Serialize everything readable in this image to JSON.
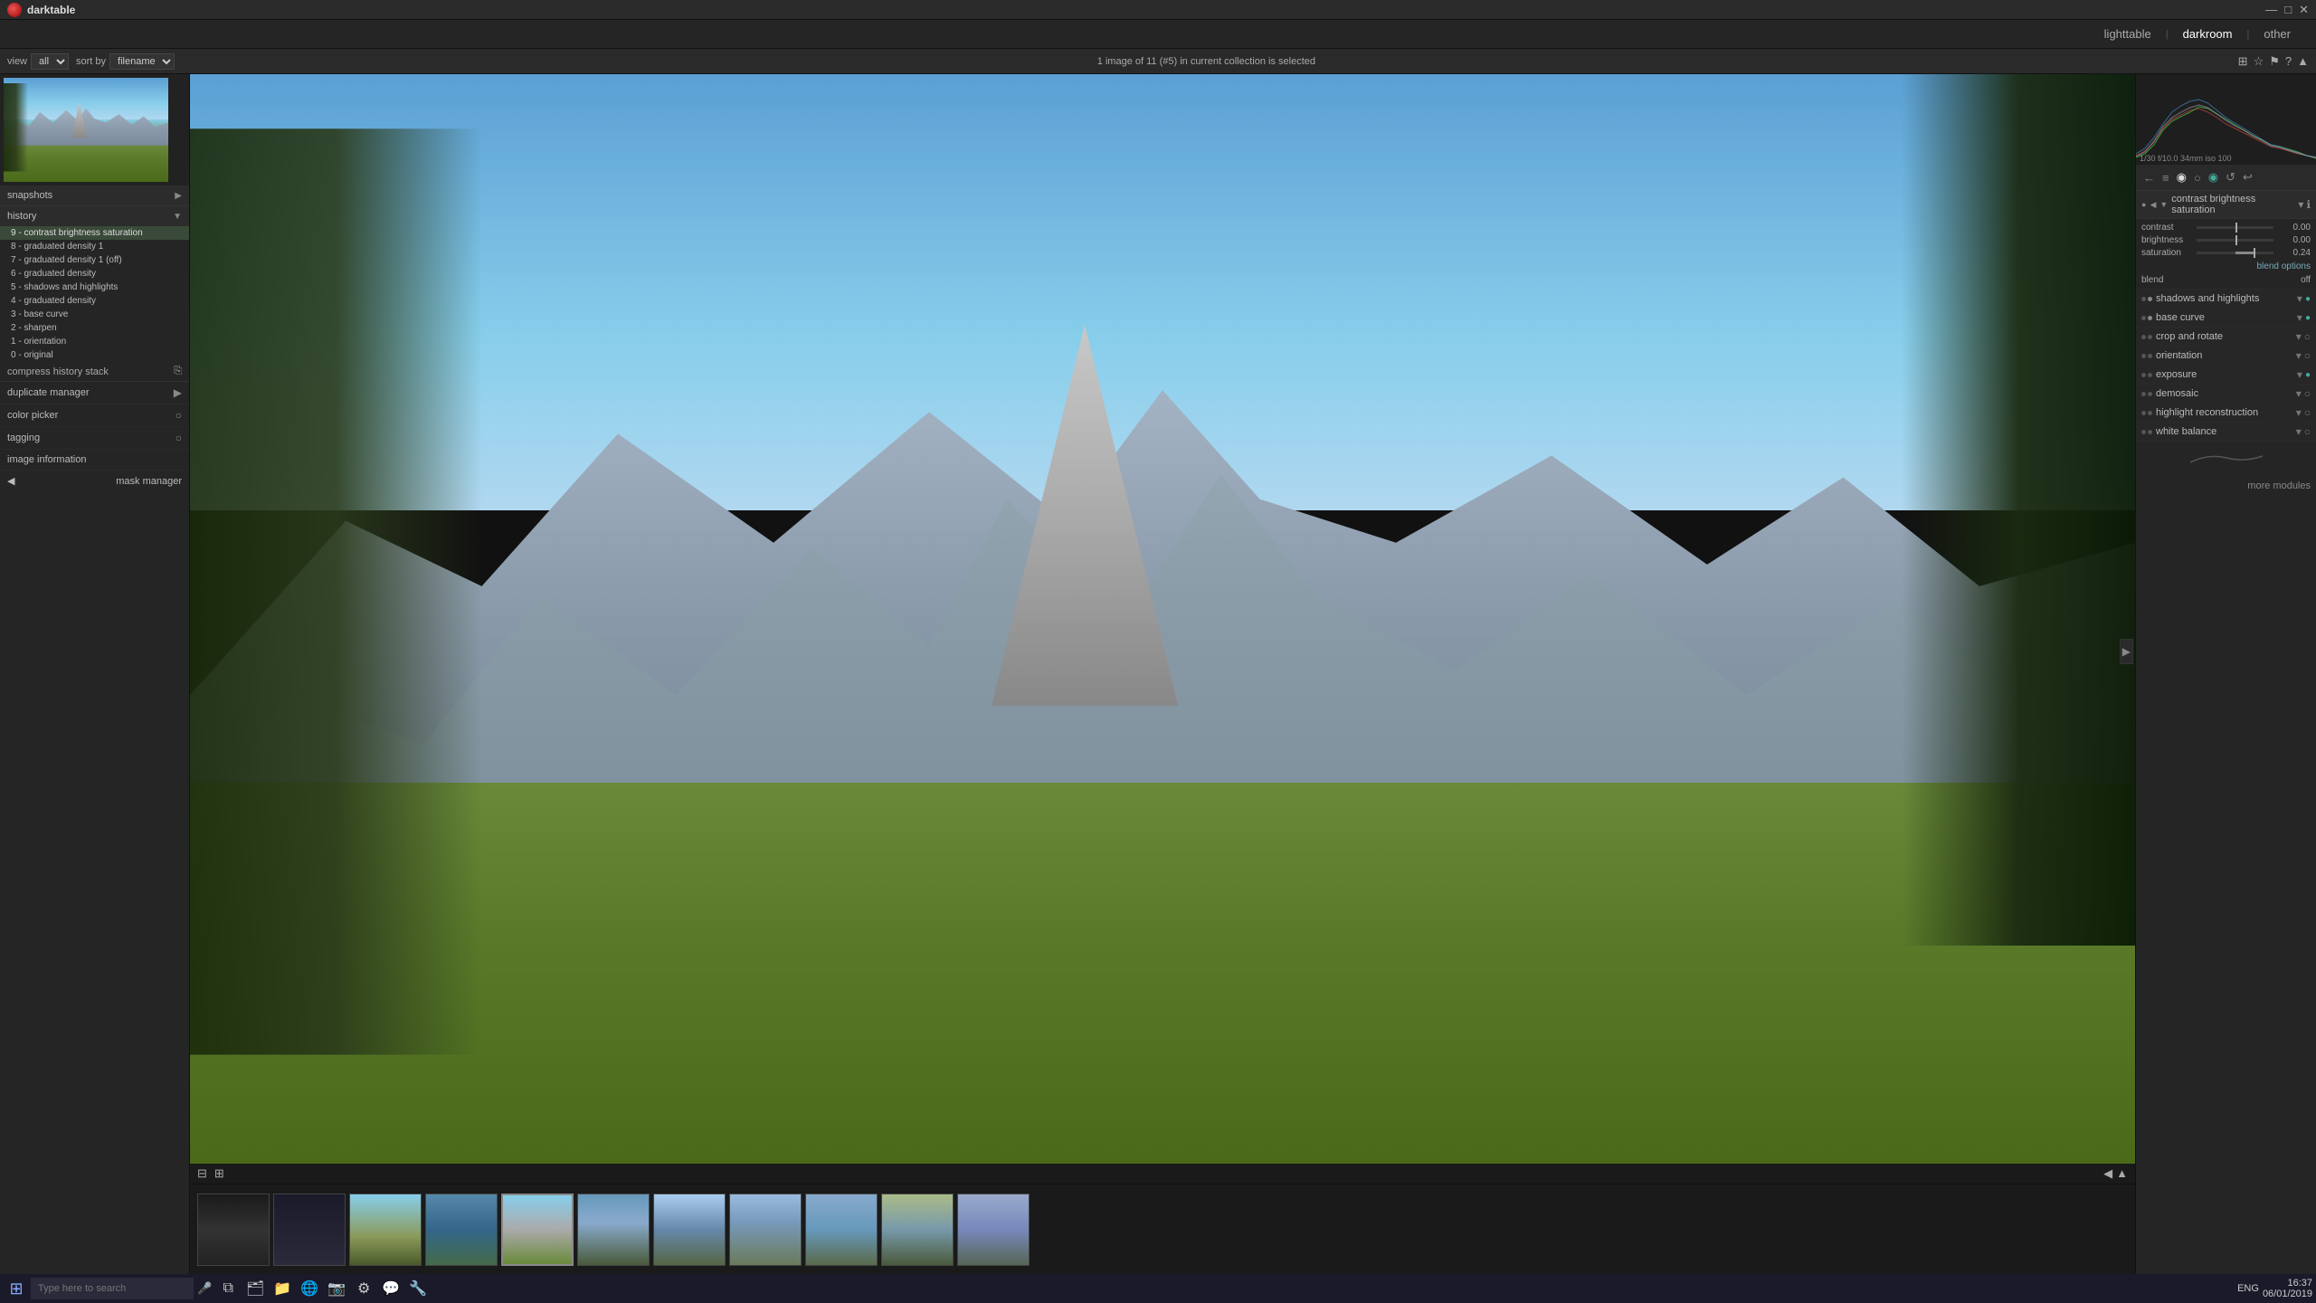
{
  "app": {
    "name": "darktable",
    "window_title": "darktable"
  },
  "window_controls": {
    "minimize": "—",
    "maximize": "□",
    "close": "✕"
  },
  "nav": {
    "tabs": [
      "lighttable",
      "darkroom",
      "other"
    ],
    "active": "darkroom",
    "separators": [
      "|",
      "|"
    ]
  },
  "toolbar": {
    "view_label": "view",
    "view_value": "all",
    "sort_label": "sort by",
    "sort_value": "filename",
    "center_text": "1 image of 11 (#5) in current collection is selected"
  },
  "left_panel": {
    "snapshots_label": "snapshots",
    "history_label": "history",
    "history_items": [
      {
        "id": 9,
        "label": "9 - contrast brightness saturation",
        "active": true
      },
      {
        "id": 8,
        "label": "8 - graduated density 1"
      },
      {
        "id": 7,
        "label": "7 - graduated density 1 (off)"
      },
      {
        "id": 6,
        "label": "6 - graduated density"
      },
      {
        "id": 5,
        "label": "5 - shadows and highlights"
      },
      {
        "id": 4,
        "label": "4 - graduated density"
      },
      {
        "id": 3,
        "label": "3 - base curve"
      },
      {
        "id": 2,
        "label": "2 - sharpen"
      },
      {
        "id": 1,
        "label": "1 - orientation"
      },
      {
        "id": 0,
        "label": "0 - original"
      }
    ],
    "compress_label": "compress history stack",
    "duplicate_manager_label": "duplicate manager",
    "color_picker_label": "color picker",
    "tagging_label": "tagging",
    "image_information_label": "image information",
    "mask_manager_label": "mask manager"
  },
  "right_panel": {
    "histogram_info": "1/30 f/10.0 34mm iso 100",
    "module_name": "contrast brightness saturation",
    "sliders": [
      {
        "label": "contrast",
        "value": "0.00",
        "fill_pct": 0
      },
      {
        "label": "brightness",
        "value": "0.00",
        "fill_pct": 0
      },
      {
        "label": "saturation",
        "value": "0.24",
        "fill_pct": 24
      }
    ],
    "blend_label": "blend",
    "blend_value": "off",
    "modules": [
      {
        "name": "shadows and highlights",
        "active": true
      },
      {
        "name": "base curve",
        "active": true
      },
      {
        "name": "crop and rotate",
        "active": false
      },
      {
        "name": "orientation",
        "active": false
      },
      {
        "name": "exposure",
        "active": true
      },
      {
        "name": "demosaic",
        "active": false
      },
      {
        "name": "highlight reconstruction",
        "active": false
      },
      {
        "name": "white balance",
        "active": false
      }
    ],
    "more_modules": "more modules"
  },
  "filmstrip": {
    "thumbs": [
      {
        "style": "ft1"
      },
      {
        "style": "ft2"
      },
      {
        "style": "ft3"
      },
      {
        "style": "ft4"
      },
      {
        "style": "ft5",
        "selected": true
      },
      {
        "style": "ft6"
      },
      {
        "style": "ft7"
      },
      {
        "style": "ft8"
      },
      {
        "style": "ft9"
      },
      {
        "style": "ft10"
      },
      {
        "style": "ft11"
      }
    ]
  },
  "taskbar": {
    "search_placeholder": "Type here to search",
    "time": "16:37",
    "date": "06/01/2019",
    "lang": "ENG"
  },
  "date_display": "06/01/2019",
  "time_display": "16:37"
}
